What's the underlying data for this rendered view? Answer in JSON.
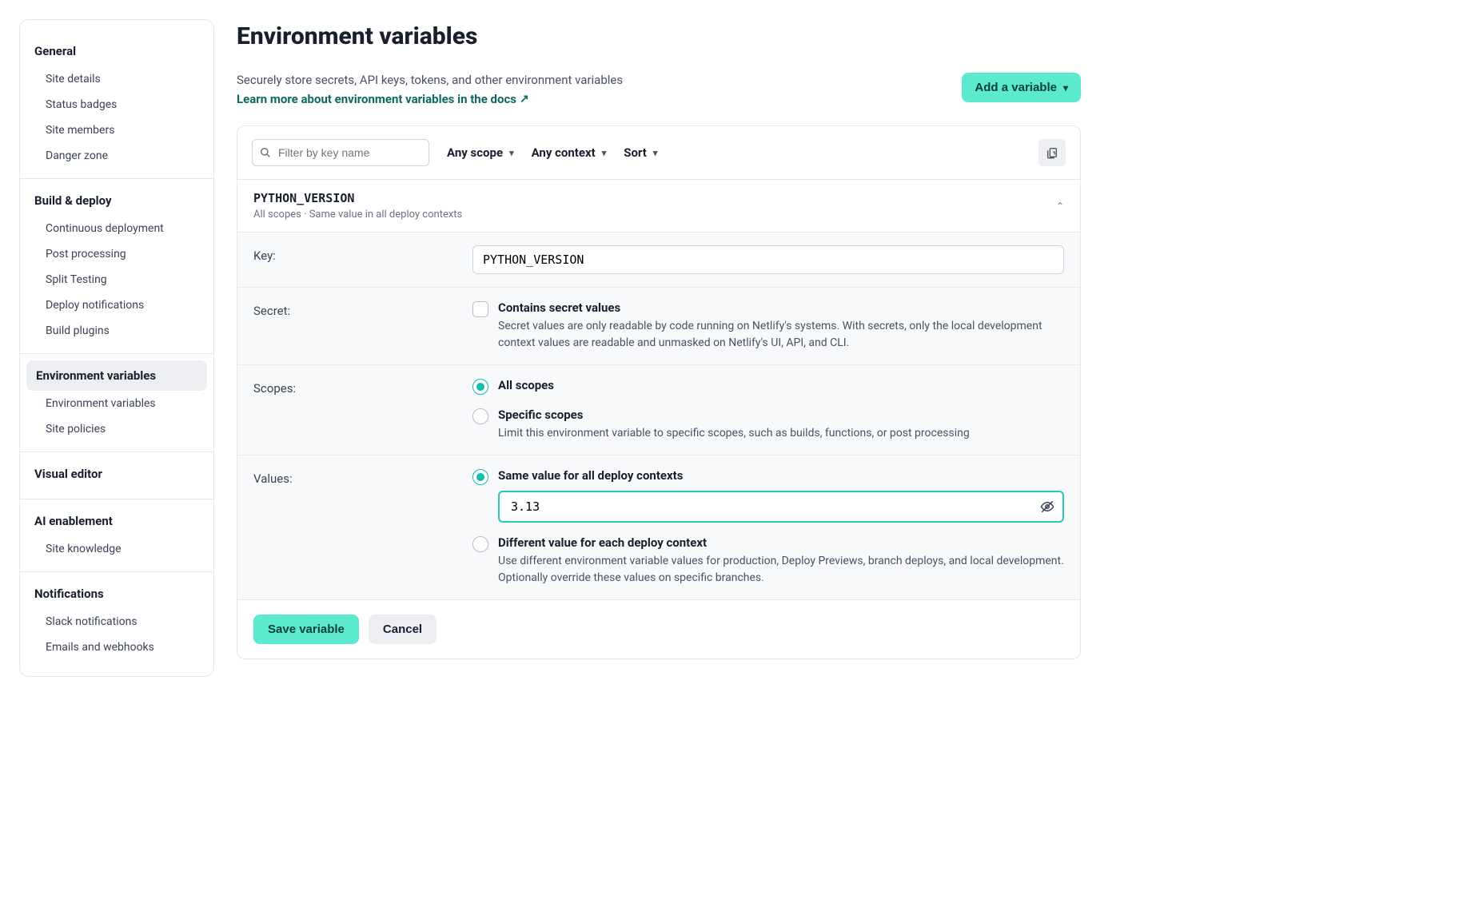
{
  "sidebar": {
    "groups": [
      {
        "heading": "General",
        "items": [
          "Site details",
          "Status badges",
          "Site members",
          "Danger zone"
        ]
      },
      {
        "heading": "Build & deploy",
        "items": [
          "Continuous deployment",
          "Post processing",
          "Split Testing",
          "Deploy notifications",
          "Build plugins"
        ]
      },
      {
        "heading": "Environment variables",
        "active": true,
        "items": [
          "Environment variables",
          "Site policies"
        ]
      },
      {
        "heading": "Visual editor",
        "items": []
      },
      {
        "heading": "AI enablement",
        "items": [
          "Site knowledge"
        ]
      },
      {
        "heading": "Notifications",
        "items": [
          "Slack notifications",
          "Emails and webhooks"
        ]
      }
    ]
  },
  "page": {
    "title": "Environment variables",
    "subtitle": "Securely store secrets, API keys, tokens, and other environment variables",
    "docs_link": "Learn more about environment variables in the docs",
    "add_variable": "Add a variable"
  },
  "toolbar": {
    "filter_placeholder": "Filter by key name",
    "scope_label": "Any scope",
    "context_label": "Any context",
    "sort_label": "Sort"
  },
  "variable": {
    "key": "PYTHON_VERSION",
    "subtext": "All scopes  ·  Same value in all deploy contexts"
  },
  "form": {
    "key_label": "Key:",
    "key_value": "PYTHON_VERSION",
    "secret_label": "Secret:",
    "secret_opt_label": "Contains secret values",
    "secret_opt_desc": "Secret values are only readable by code running on Netlify's systems. With secrets, only the local development context values are readable and unmasked on Netlify's UI, API, and CLI.",
    "scopes_label": "Scopes:",
    "scopes_all_label": "All scopes",
    "scopes_specific_label": "Specific scopes",
    "scopes_specific_desc": "Limit this environment variable to specific scopes, such as builds, functions, or post processing",
    "values_label": "Values:",
    "values_same_label": "Same value for all deploy contexts",
    "values_value": "3.13",
    "values_diff_label": "Different value for each deploy context",
    "values_diff_desc": "Use different environment variable values for production, Deploy Previews, branch deploys, and local development. Optionally override these values on specific branches.",
    "save_label": "Save variable",
    "cancel_label": "Cancel"
  }
}
